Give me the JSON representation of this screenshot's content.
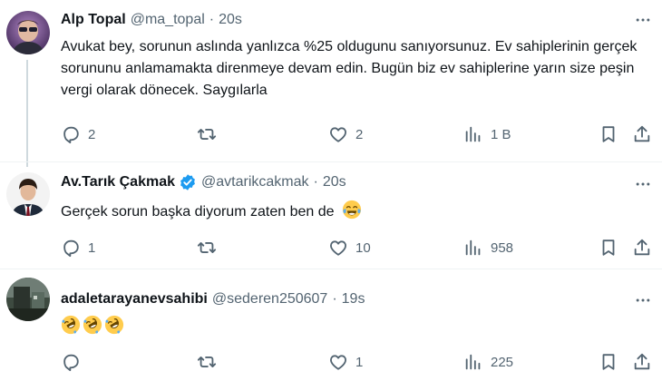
{
  "tweets": [
    {
      "name": "Alp Topal",
      "handle": "@ma_topal",
      "time": "20s",
      "text": "Avukat bey, sorunun aslında yanlızca %25 oldugunu sanıyorsunuz. Ev sahiplerinin gerçek sorununu anlamamakta direnmeye devam edin. Bugün biz ev sahiplerine yarın size peşin vergi olarak dönecek. Saygılarla",
      "replies": "2",
      "retweets": "",
      "likes": "2",
      "views": "1 B"
    },
    {
      "name": "Av.Tarık Çakmak",
      "handle": "@avtarikcakmak",
      "time": "20s",
      "verified": true,
      "text": "Gerçek sorun başka diyorum zaten ben de",
      "emoji": [
        "face-with-tears-of-joy"
      ],
      "replies": "1",
      "retweets": "",
      "likes": "10",
      "views": "958"
    },
    {
      "name": "adaletarayanevsahibi",
      "handle": "@sederen250607",
      "time": "19s",
      "text": "",
      "emoji": [
        "rolling-on-floor-laughing",
        "rolling-on-floor-laughing",
        "rolling-on-floor-laughing"
      ],
      "replies": "",
      "retweets": "",
      "likes": "1",
      "views": "225"
    }
  ],
  "colors": {
    "text": "#0f1419",
    "secondary": "#536471",
    "verified": "#1d9bf0",
    "divider": "#eff3f4"
  }
}
